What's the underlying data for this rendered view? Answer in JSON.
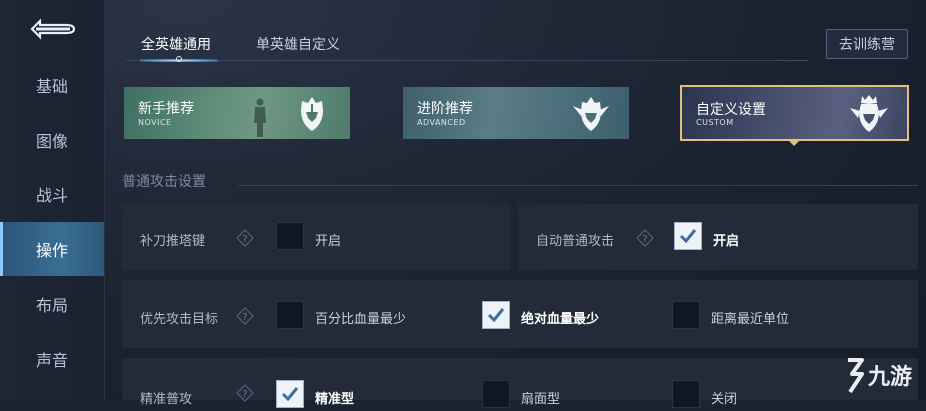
{
  "sidebar": {
    "items": [
      {
        "label": "基础"
      },
      {
        "label": "图像"
      },
      {
        "label": "战斗"
      },
      {
        "label": "操作",
        "active": true
      },
      {
        "label": "布局"
      },
      {
        "label": "声音"
      }
    ]
  },
  "tabs": [
    {
      "label": "全英雄通用",
      "active": true
    },
    {
      "label": "单英雄自定义",
      "active": false
    }
  ],
  "train_button": "去训练营",
  "presets": [
    {
      "title": "新手推荐",
      "subtitle": "NOVICE",
      "selected": false
    },
    {
      "title": "进阶推荐",
      "subtitle": "ADVANCED",
      "selected": false
    },
    {
      "title": "自定义设置",
      "subtitle": "CUSTOM",
      "selected": true
    }
  ],
  "section": {
    "title": "普通攻击设置",
    "rows": {
      "last_hit": {
        "label": "补刀推塔键",
        "option": "开启",
        "checked": false
      },
      "auto_attack": {
        "label": "自动普通攻击",
        "option": "开启",
        "checked": true
      },
      "priority": {
        "label": "优先攻击目标",
        "options": [
          {
            "label": "百分比血量最少",
            "checked": false
          },
          {
            "label": "绝对血量最少",
            "checked": true
          },
          {
            "label": "距离最近单位",
            "checked": false
          }
        ]
      },
      "precise": {
        "label": "精准普攻",
        "options": [
          {
            "label": "精准型",
            "checked": true
          },
          {
            "label": "扇面型",
            "checked": false
          },
          {
            "label": "关闭",
            "checked": false
          }
        ]
      }
    }
  },
  "watermark": "九游",
  "colors": {
    "accent_gold": "#e3c07a",
    "active_tab": "#3a6d93",
    "checkbox_checked": "#eef3f8"
  }
}
